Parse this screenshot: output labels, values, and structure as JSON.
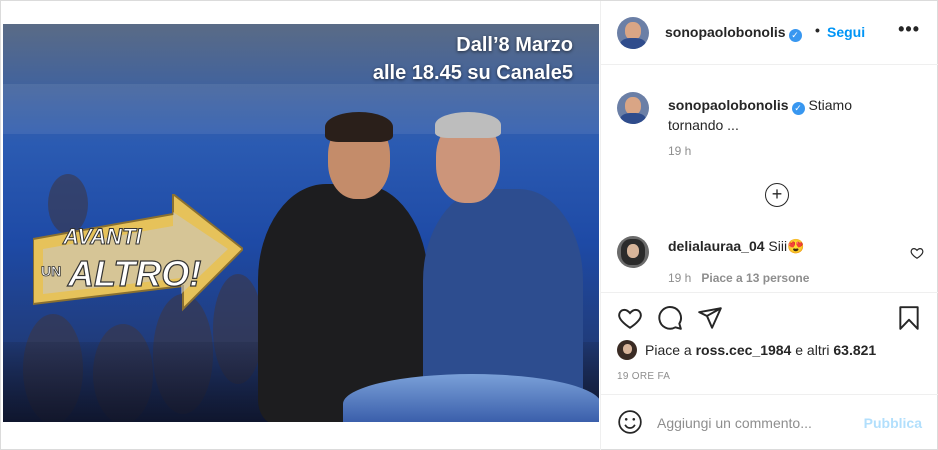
{
  "media": {
    "overlay_line1": "Dall’8 Marzo",
    "overlay_line2": "alle 18.45 su Canale5",
    "logo_line1": "AVANTI",
    "logo_line2": "UN",
    "logo_line3": "ALTRO!"
  },
  "header": {
    "username": "sonopaolobonolis",
    "separator": "•",
    "follow_label": "Segui"
  },
  "caption": {
    "username": "sonopaolobonolis",
    "text": "Stiamo tornando ...",
    "time": "19 h"
  },
  "comment": {
    "username": "delialauraa_04",
    "text": "Siii😍",
    "time": "19 h",
    "likes": "Piace a 13 persone"
  },
  "likes": {
    "prefix": "Piace a",
    "user": "ross.cec_1984",
    "middle": "e altri",
    "count": "63.821"
  },
  "post_time": "19 ORE FA",
  "add_comment": {
    "placeholder": "Aggiungi un commento...",
    "publish_label": "Pubblica"
  },
  "colors": {
    "accent": "#0095f6",
    "verified": "#3897f0",
    "publish_disabled": "#b2dffc"
  }
}
